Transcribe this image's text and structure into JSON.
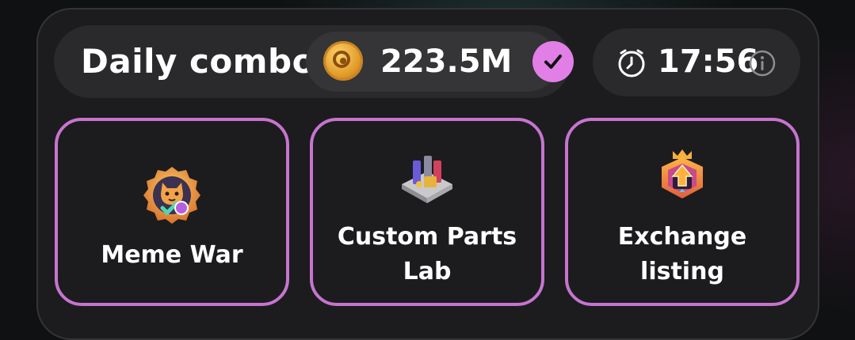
{
  "header": {
    "title": "Daily combo",
    "reward": "223.5M",
    "timer": "17:56"
  },
  "cards": [
    {
      "label": "Meme War",
      "icon": "cat-badge-icon"
    },
    {
      "label": "Custom Parts Lab",
      "label_line1": "Custom Parts",
      "label_line2": "Lab",
      "icon": "parts-lab-icon"
    },
    {
      "label": "Exchange listing",
      "label_line1": "Exchange",
      "label_line2": "listing",
      "icon": "exchange-listing-icon"
    }
  ],
  "colors": {
    "accent": "#e27fe7",
    "card_border": "#c774cf",
    "panel": "#1c1c1e"
  }
}
